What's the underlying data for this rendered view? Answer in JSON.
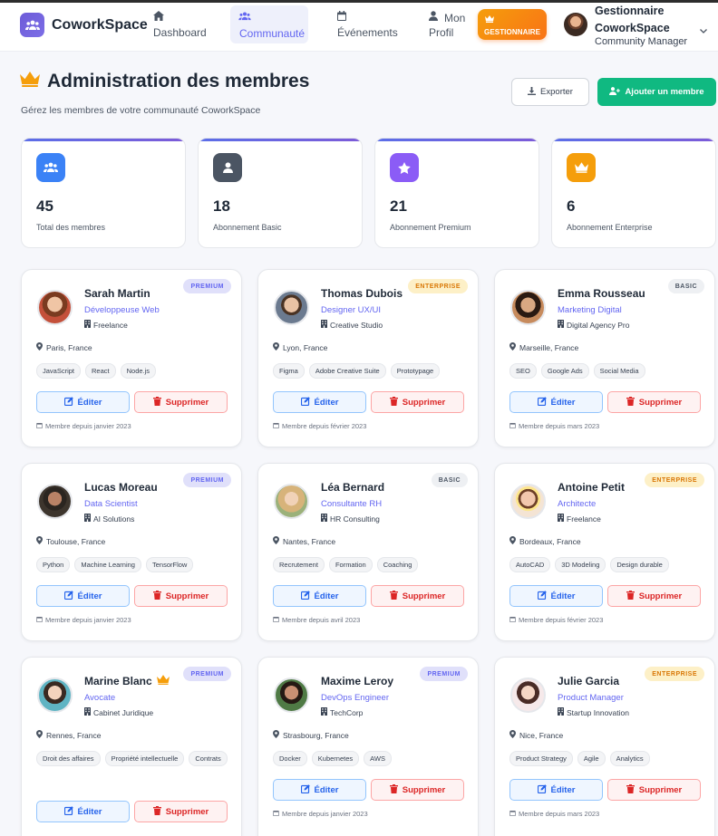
{
  "brand": {
    "name": "CoworkSpace"
  },
  "nav": {
    "dashboard": "Dashboard",
    "community": "Communauté",
    "events": "Événements",
    "profile_1": "Mon",
    "profile_2": "Profil",
    "manager_badge": "GESTIONNAIRE"
  },
  "user": {
    "name": "Gestionnaire CoworkSpace",
    "role": "Community Manager"
  },
  "header": {
    "title": "Administration des membres",
    "subtitle": "Gérez les membres de votre communauté CoworkSpace",
    "export_label": "Exporter",
    "add_label": "Ajouter un membre"
  },
  "stats": [
    {
      "value": "45",
      "label": "Total des membres",
      "color": "#3b82f6",
      "icon": "users-icon"
    },
    {
      "value": "18",
      "label": "Abonnement Basic",
      "color": "#4b5563",
      "icon": "user-icon"
    },
    {
      "value": "21",
      "label": "Abonnement Premium",
      "color": "#8b5cf6",
      "icon": "star-icon"
    },
    {
      "value": "6",
      "label": "Abonnement Enterprise",
      "color": "#f59e0b",
      "icon": "crown-icon"
    }
  ],
  "actions": {
    "edit": "Éditer",
    "delete": "Supprimer"
  },
  "members": [
    {
      "name": "Sarah Martin",
      "role": "Développeuse Web",
      "company": "Freelance",
      "plan": "PREMIUM",
      "location": "Paris, France",
      "tags": [
        "JavaScript",
        "React",
        "Node.js"
      ],
      "since": "Membre depuis janvier 2023"
    },
    {
      "name": "Thomas Dubois",
      "role": "Designer UX/UI",
      "company": "Creative Studio",
      "plan": "ENTERPRISE",
      "location": "Lyon, France",
      "tags": [
        "Figma",
        "Adobe Creative Suite",
        "Prototypage"
      ],
      "since": "Membre depuis février 2023"
    },
    {
      "name": "Emma Rousseau",
      "role": "Marketing Digital",
      "company": "Digital Agency Pro",
      "plan": "BASIC",
      "location": "Marseille, France",
      "tags": [
        "SEO",
        "Google Ads",
        "Social Media"
      ],
      "since": "Membre depuis mars 2023"
    },
    {
      "name": "Lucas Moreau",
      "role": "Data Scientist",
      "company": "AI Solutions",
      "plan": "PREMIUM",
      "location": "Toulouse, France",
      "tags": [
        "Python",
        "Machine Learning",
        "TensorFlow"
      ],
      "since": "Membre depuis janvier 2023"
    },
    {
      "name": "Léa Bernard",
      "role": "Consultante RH",
      "company": "HR Consulting",
      "plan": "BASIC",
      "location": "Nantes, France",
      "tags": [
        "Recrutement",
        "Formation",
        "Coaching"
      ],
      "since": "Membre depuis avril 2023"
    },
    {
      "name": "Antoine Petit",
      "role": "Architecte",
      "company": "Freelance",
      "plan": "ENTERPRISE",
      "location": "Bordeaux, France",
      "tags": [
        "AutoCAD",
        "3D Modeling",
        "Design durable"
      ],
      "since": "Membre depuis février 2023"
    },
    {
      "name": "Marine Blanc",
      "role": "Avocate",
      "company": "Cabinet Juridique",
      "plan": "PREMIUM",
      "location": "Rennes, France",
      "tags": [
        "Droit des affaires",
        "Propriété intellectuelle",
        "Contrats"
      ],
      "since": "",
      "crown": true
    },
    {
      "name": "Maxime Leroy",
      "role": "DevOps Engineer",
      "company": "TechCorp",
      "plan": "PREMIUM",
      "location": "Strasbourg, France",
      "tags": [
        "Docker",
        "Kubernetes",
        "AWS"
      ],
      "since": "Membre depuis janvier 2023"
    },
    {
      "name": "Julie Garcia",
      "role": "Product Manager",
      "company": "Startup Innovation",
      "plan": "ENTERPRISE",
      "location": "Nice, France",
      "tags": [
        "Product Strategy",
        "Agile",
        "Analytics"
      ],
      "since": "Membre depuis mars 2023"
    }
  ]
}
